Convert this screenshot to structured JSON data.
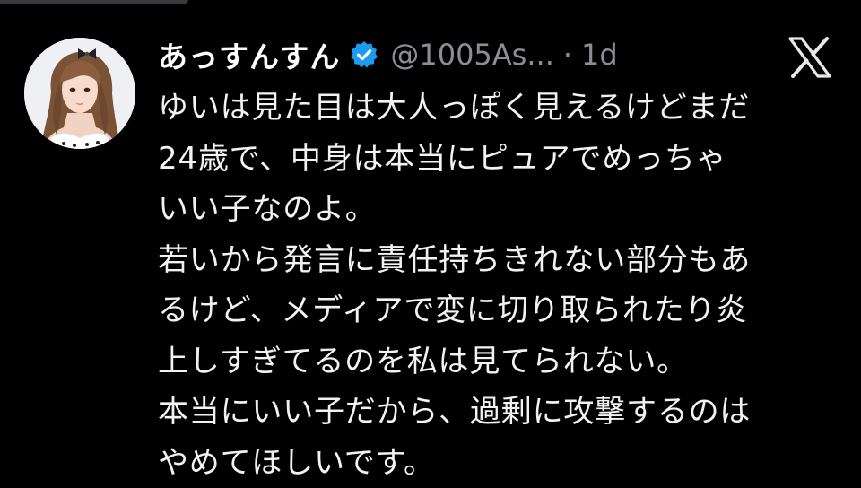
{
  "tweet": {
    "display_name": "あっすんすん",
    "handle": "@1005As...",
    "separator": "·",
    "time": "1d",
    "verified": true,
    "lines": [
      "ゆいは見た目は大人っぽく見えるけどまだ",
      "24歳で、中身は本当にピュアでめっちゃ",
      "いい子なのよ。",
      "若いから発言に責任持ちきれない部分もあ",
      "るけど、メディアで変に切り取られたり炎",
      "上しすぎてるのを私は見てられない。",
      "本当にいい子だから、過剰に攻撃するのは",
      "やめてほしいです。"
    ]
  },
  "icons": {
    "verified": "verified-badge-icon",
    "brand": "x-logo-icon",
    "avatar": "avatar"
  },
  "colors": {
    "background": "#000000",
    "text": "#f2f2f2",
    "muted": "#8a8f96",
    "verified": "#1d9bf0"
  }
}
